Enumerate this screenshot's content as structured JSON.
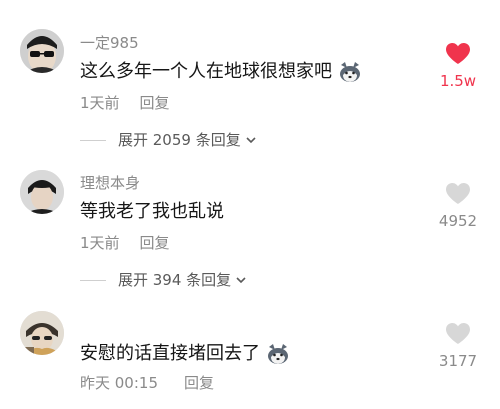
{
  "colors": {
    "liked": "#f0344d",
    "unliked": "#d7d7d7",
    "muted_text": "#8a8a8a",
    "primary_text": "#161616"
  },
  "comments": [
    {
      "username": "一定985",
      "text": "这么多年一个人在地球很想家吧",
      "emoji": "husky-dog-emoji",
      "time": "1天前",
      "reply_label": "回复",
      "expand_label": "展开 2059 条回复",
      "likes": "1.5w",
      "liked": true
    },
    {
      "username": "理想本身",
      "text": "等我老了我也乱说",
      "emoji": "",
      "time": "1天前",
      "reply_label": "回复",
      "expand_label": "展开 394 条回复",
      "likes": "4952",
      "liked": false
    },
    {
      "username": "",
      "text": "安慰的话直接堵回去了",
      "emoji": "husky-dog-emoji",
      "time": "昨天 00:15",
      "reply_label": "回复",
      "expand_label": "",
      "likes": "3177",
      "liked": false
    }
  ]
}
